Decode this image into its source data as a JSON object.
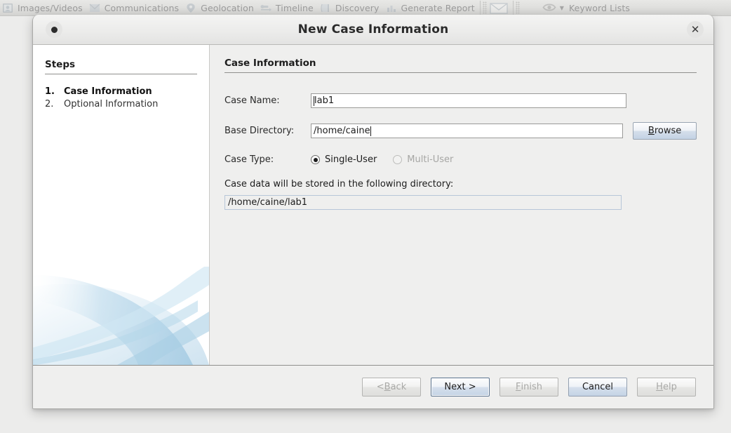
{
  "app_toolbar": {
    "items": [
      {
        "icon": "images-videos-icon",
        "label": "Images/Videos"
      },
      {
        "icon": "communications-icon",
        "label": "Communications"
      },
      {
        "icon": "geolocation-pin-icon",
        "label": "Geolocation"
      },
      {
        "icon": "timeline-icon",
        "label": "Timeline"
      },
      {
        "icon": "discovery-icon",
        "label": "Discovery"
      },
      {
        "icon": "generate-report-icon",
        "label": "Generate Report"
      }
    ],
    "mail_icon": "envelope-icon",
    "keyword_icon": "eye-icon",
    "keyword_label": "Keyword Lists"
  },
  "dialog": {
    "title": "New Case Information",
    "menu_icon": "window-menu-dot-icon",
    "close_icon": "close-icon",
    "steps": {
      "heading": "Steps",
      "items": [
        {
          "num": "1.",
          "label": "Case Information",
          "active": true
        },
        {
          "num": "2.",
          "label": "Optional Information",
          "active": false
        }
      ]
    },
    "content": {
      "section_title": "Case Information",
      "case_name": {
        "label": "Case Name:",
        "value": "lab1",
        "placeholder": ""
      },
      "base_directory": {
        "label": "Base Directory:",
        "value": "/home/caine",
        "placeholder": "",
        "browse_label_pre": "",
        "browse_mnemonic": "B",
        "browse_label_post": "rowse"
      },
      "case_type": {
        "label": "Case Type:",
        "options": [
          {
            "label": "Single-User",
            "selected": true,
            "disabled": false
          },
          {
            "label": "Multi-User",
            "selected": false,
            "disabled": true
          }
        ]
      },
      "store_note": "Case data will be stored in the following directory:",
      "store_path": "/home/caine/lab1"
    },
    "footer_buttons": [
      {
        "name": "back",
        "pre": "< ",
        "mnemonic": "B",
        "post": "ack",
        "enabled": false,
        "default": false
      },
      {
        "name": "next",
        "pre": "",
        "mnemonic": "",
        "post": "Next >",
        "enabled": true,
        "default": true
      },
      {
        "name": "finish",
        "pre": "",
        "mnemonic": "F",
        "post": "inish",
        "enabled": false,
        "default": false
      },
      {
        "name": "cancel",
        "pre": "",
        "mnemonic": "",
        "post": "Cancel",
        "enabled": true,
        "default": false
      },
      {
        "name": "help",
        "pre": "",
        "mnemonic": "H",
        "post": "elp",
        "enabled": false,
        "default": false
      }
    ]
  },
  "colors": {
    "accent_blue": "#c4d3e5",
    "dialog_bg": "#efefee",
    "sidebar_bg": "#ffffff",
    "artwork_blue": "#bcd8ea"
  }
}
